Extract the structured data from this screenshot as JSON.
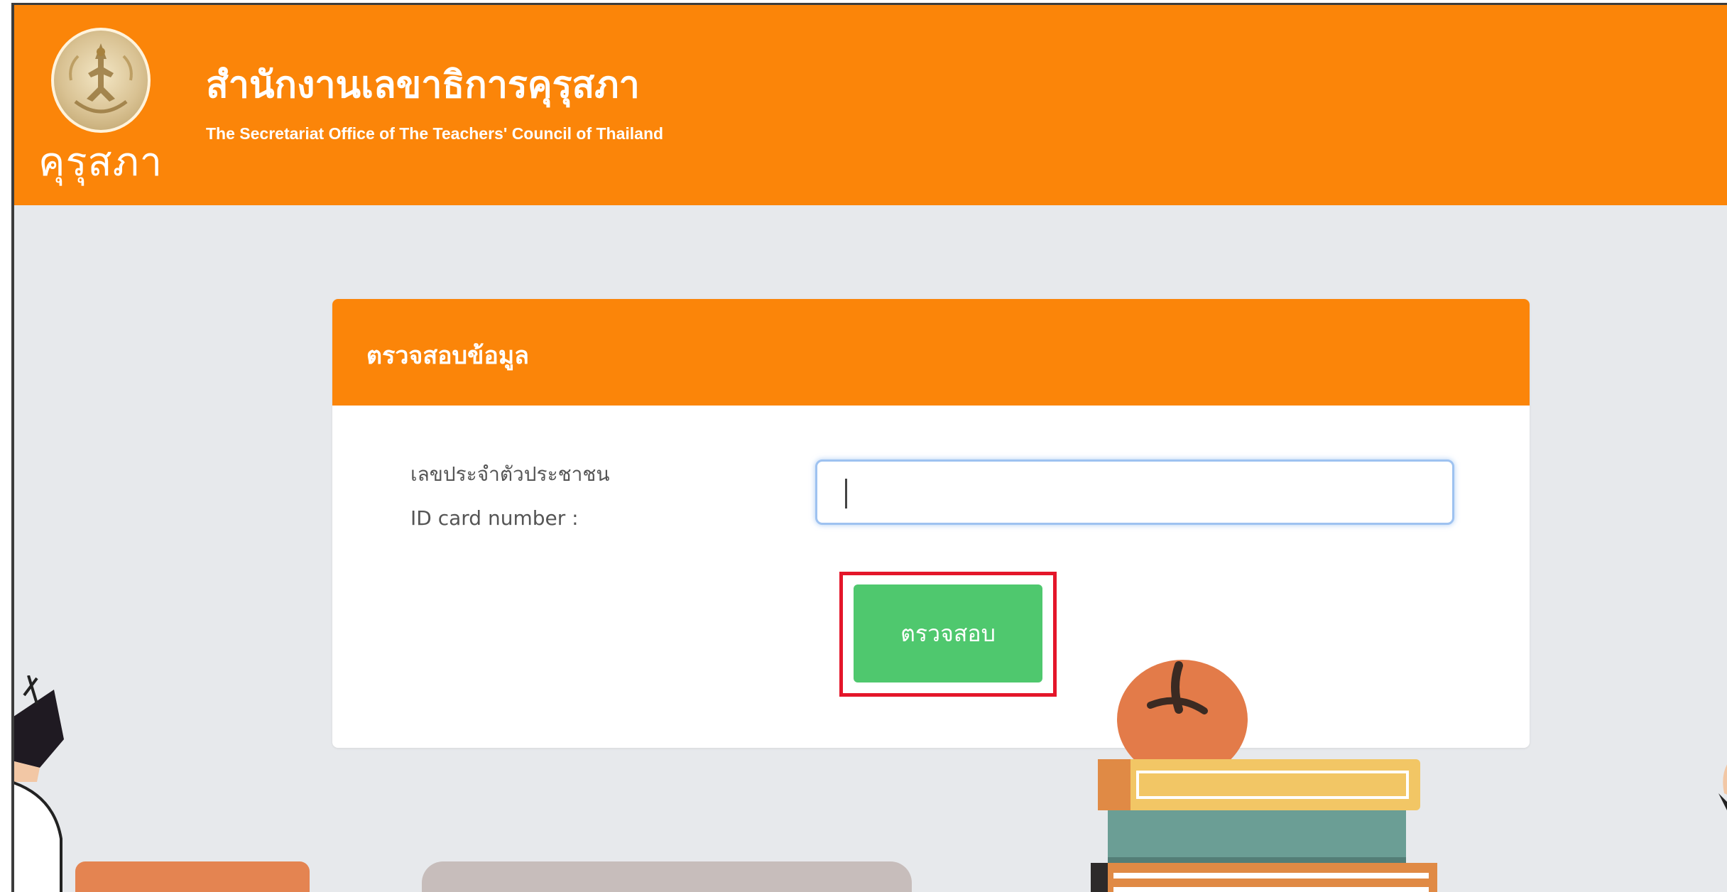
{
  "header": {
    "logo_text": "คุรุสภา",
    "org_name_thai": "สำนักงานเลขาธิการคุรุสภา",
    "org_name_en": "The Secretariat Office of The Teachers' Council of Thailand"
  },
  "card": {
    "title": "ตรวจสอบข้อมูล",
    "label_thai": "เลขประจำตัวประชาชน",
    "label_en": "ID card number :",
    "input_value": "",
    "button_label": "ตรวจสอบ"
  },
  "colors": {
    "header_orange": "#fb8509",
    "button_green": "#4fc86e",
    "highlight_red": "#e4162a",
    "background_gray": "#e7e9ec"
  },
  "icons": {
    "logo": "seal-emblem-icon",
    "decorations": [
      "apple-icon",
      "book-stack-icon",
      "character-illustration-icon"
    ]
  }
}
